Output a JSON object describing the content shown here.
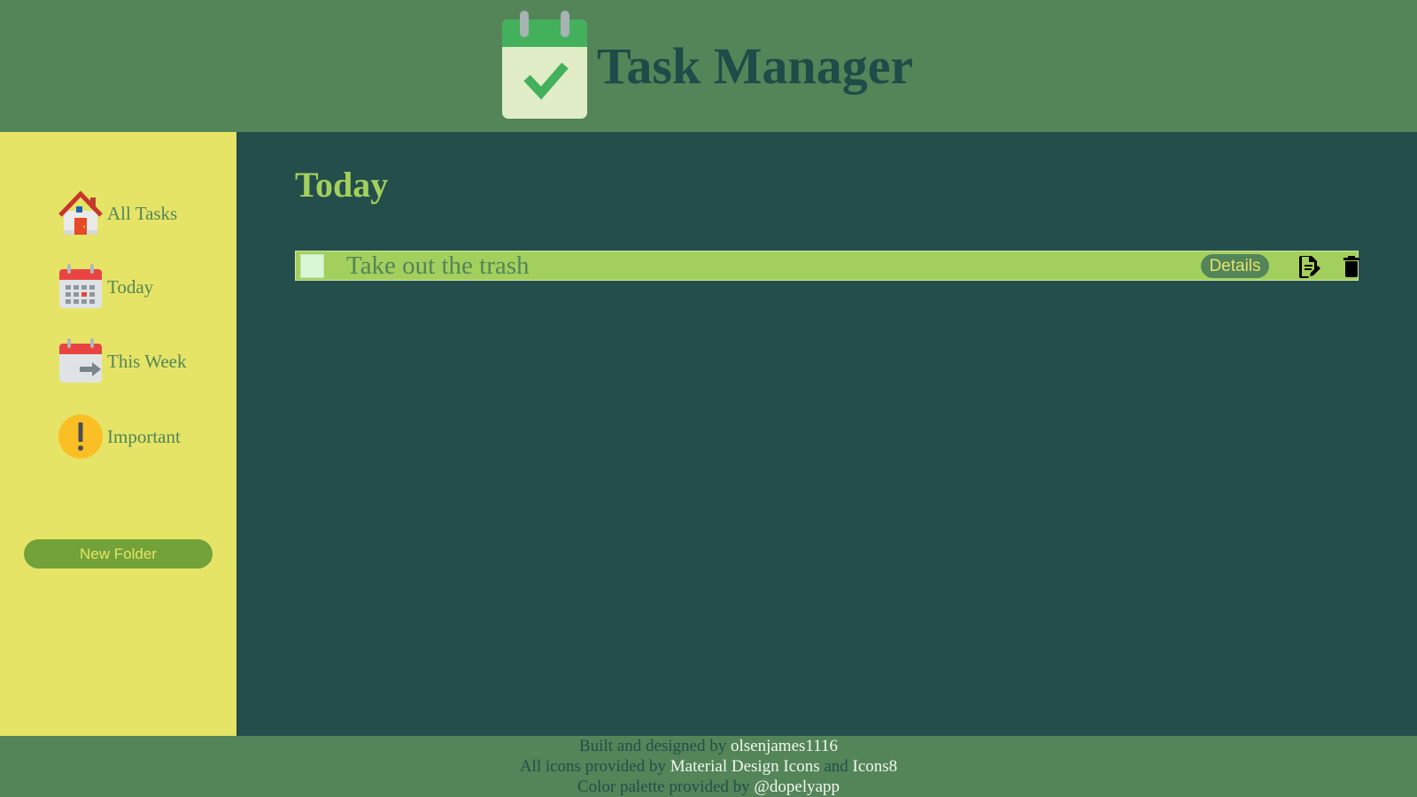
{
  "header": {
    "title": "Task Manager",
    "logo_icon": "calendar-check-icon"
  },
  "sidebar": {
    "items": [
      {
        "label": "All Tasks",
        "icon": "house-icon"
      },
      {
        "label": "Today",
        "icon": "calendar-icon"
      },
      {
        "label": "This Week",
        "icon": "calendar-arrow-icon"
      },
      {
        "label": "Important",
        "icon": "exclamation-icon"
      }
    ],
    "new_folder_label": "New Folder"
  },
  "main": {
    "title": "Today",
    "tasks": [
      {
        "text": "Take out the trash",
        "checked": false,
        "details_label": "Details"
      }
    ]
  },
  "footer": {
    "line1_prefix": "Built and designed by",
    "line1_link": "olsenjames1116",
    "line2_prefix": "All icons provided by",
    "line2_link1": "Material Design Icons",
    "line2_middle": "and",
    "line2_link2": "Icons8",
    "line3_prefix": "Color palette provided by",
    "line3_link": "@dopelyapp"
  },
  "colors": {
    "header_bg": "#538559",
    "sidebar_bg": "#e5e466",
    "main_bg": "#244e4b",
    "task_bg": "#a3cf5d",
    "button_bg": "#72a239"
  }
}
